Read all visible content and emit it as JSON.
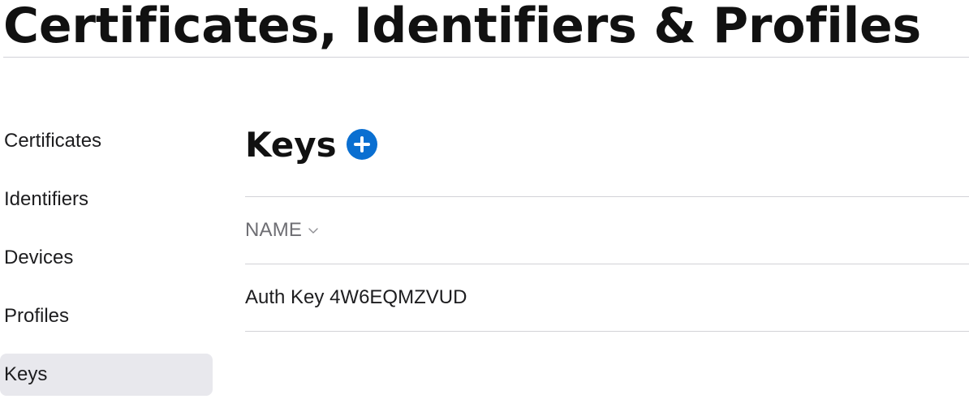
{
  "page": {
    "title": "Certificates, Identifiers & Profiles"
  },
  "sidebar": {
    "items": [
      {
        "label": "Certificates",
        "active": false
      },
      {
        "label": "Identifiers",
        "active": false
      },
      {
        "label": "Devices",
        "active": false
      },
      {
        "label": "Profiles",
        "active": false
      },
      {
        "label": "Keys",
        "active": true
      }
    ]
  },
  "main": {
    "section_title": "Keys",
    "add_icon": "plus-circle-icon",
    "table": {
      "columns": [
        {
          "label": "NAME",
          "sort_icon": "chevron-down-icon"
        }
      ],
      "rows": [
        {
          "name": "Auth Key 4W6EQMZVUD"
        }
      ]
    }
  },
  "colors": {
    "accent": "#0a6fd1",
    "active_item_bg": "#e8e8ed",
    "divider": "#d2d2d7",
    "muted_text": "#6e6e73",
    "text": "#1d1d1f"
  }
}
